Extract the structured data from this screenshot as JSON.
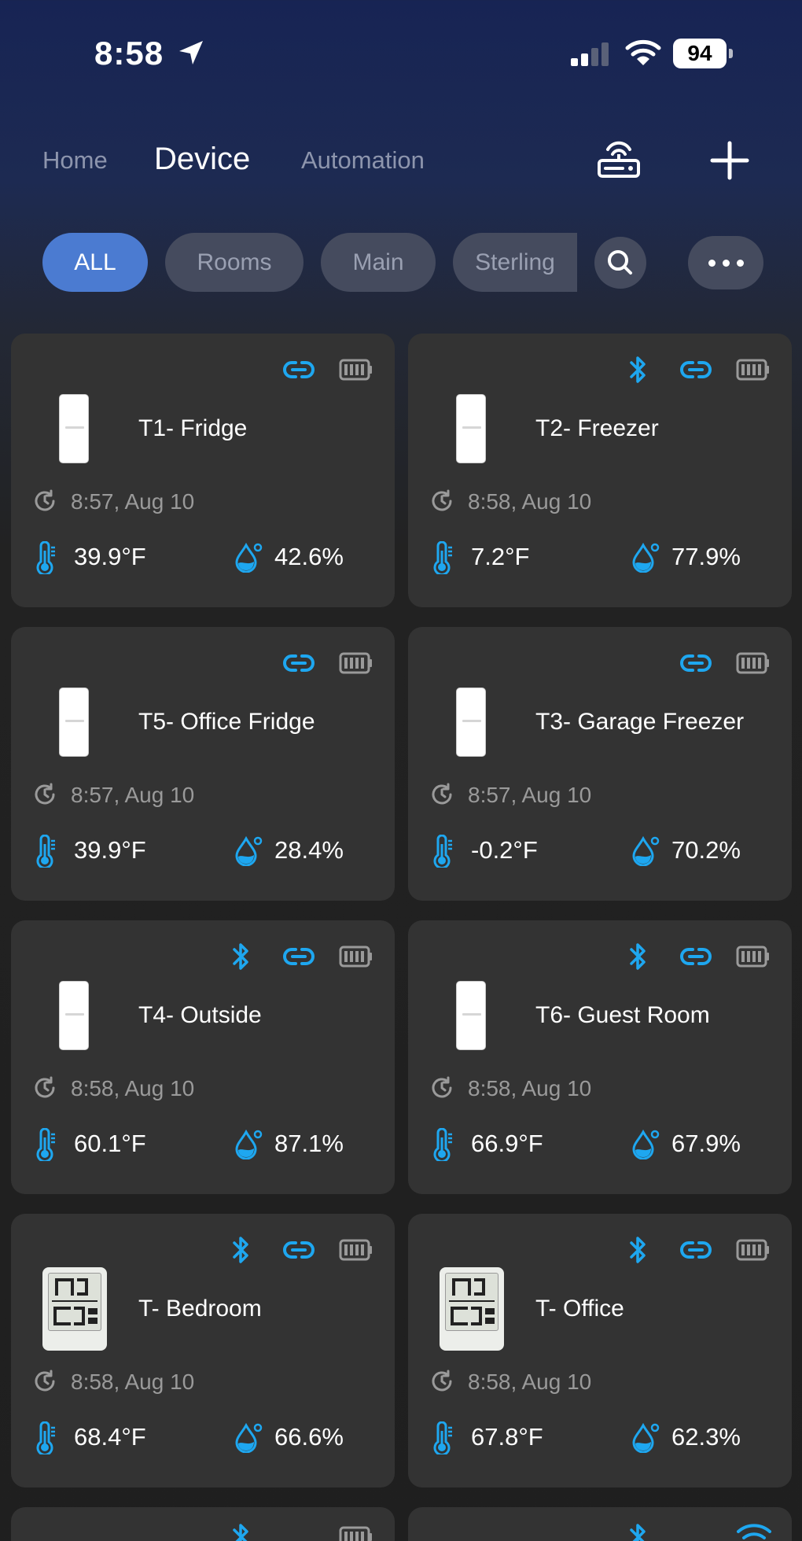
{
  "status_bar": {
    "time": "8:58",
    "battery": "94"
  },
  "header": {
    "tabs": [
      {
        "label": "Home"
      },
      {
        "label": "Device"
      },
      {
        "label": "Automation"
      }
    ]
  },
  "filters": {
    "chips": [
      {
        "label": "ALL"
      },
      {
        "label": "Rooms"
      },
      {
        "label": "Main"
      },
      {
        "label": "Sterling"
      }
    ]
  },
  "colors": {
    "accent": "#1ea7f0",
    "chip_active": "#4b7bd1"
  },
  "devices": [
    {
      "name": "T1- Fridge",
      "time": "8:57,  Aug 10",
      "temp": "39.9°F",
      "humidity": "42.6%",
      "bluetooth": false,
      "thumb": "sensor-white"
    },
    {
      "name": "T2- Freezer",
      "time": "8:58,  Aug 10",
      "temp": "7.2°F",
      "humidity": "77.9%",
      "bluetooth": true,
      "thumb": "sensor-white"
    },
    {
      "name": "T5- Office Fridge",
      "time": "8:57,  Aug 10",
      "temp": "39.9°F",
      "humidity": "28.4%",
      "bluetooth": false,
      "thumb": "sensor-white"
    },
    {
      "name": "T3- Garage Freezer",
      "time": "8:57,  Aug 10",
      "temp": "-0.2°F",
      "humidity": "70.2%",
      "bluetooth": false,
      "thumb": "sensor-white"
    },
    {
      "name": "T4- Outside",
      "time": "8:58,  Aug 10",
      "temp": "60.1°F",
      "humidity": "87.1%",
      "bluetooth": true,
      "thumb": "sensor-white"
    },
    {
      "name": "T6- Guest Room",
      "time": "8:58,  Aug 10",
      "temp": "66.9°F",
      "humidity": "67.9%",
      "bluetooth": true,
      "thumb": "sensor-white"
    },
    {
      "name": "T- Bedroom",
      "time": "8:58,  Aug 10",
      "temp": "68.4°F",
      "humidity": "66.6%",
      "bluetooth": true,
      "thumb": "lcd-display"
    },
    {
      "name": "T- Office",
      "time": "8:58,  Aug 10",
      "temp": "67.8°F",
      "humidity": "62.3%",
      "bluetooth": true,
      "thumb": "lcd-display"
    }
  ]
}
